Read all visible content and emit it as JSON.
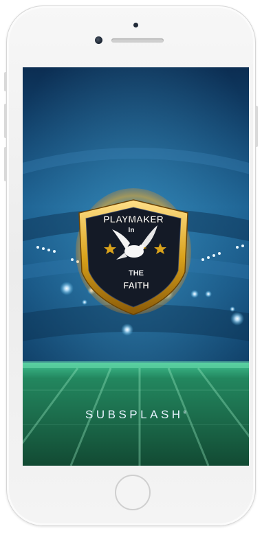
{
  "splash": {
    "logo": {
      "line1": "PLAYMAKER",
      "line2": "In",
      "line3": "THE",
      "line4": "FAITH"
    },
    "brand": "SUBSPLASH",
    "brand_mark": "®"
  },
  "colors": {
    "sky_top": "#0b2d52",
    "sky_mid": "#1b6aa0",
    "field": "#1e8a5a",
    "gold": "#d9a21b",
    "shield_dark": "#111827",
    "logo_text": "#f2f2f2"
  }
}
